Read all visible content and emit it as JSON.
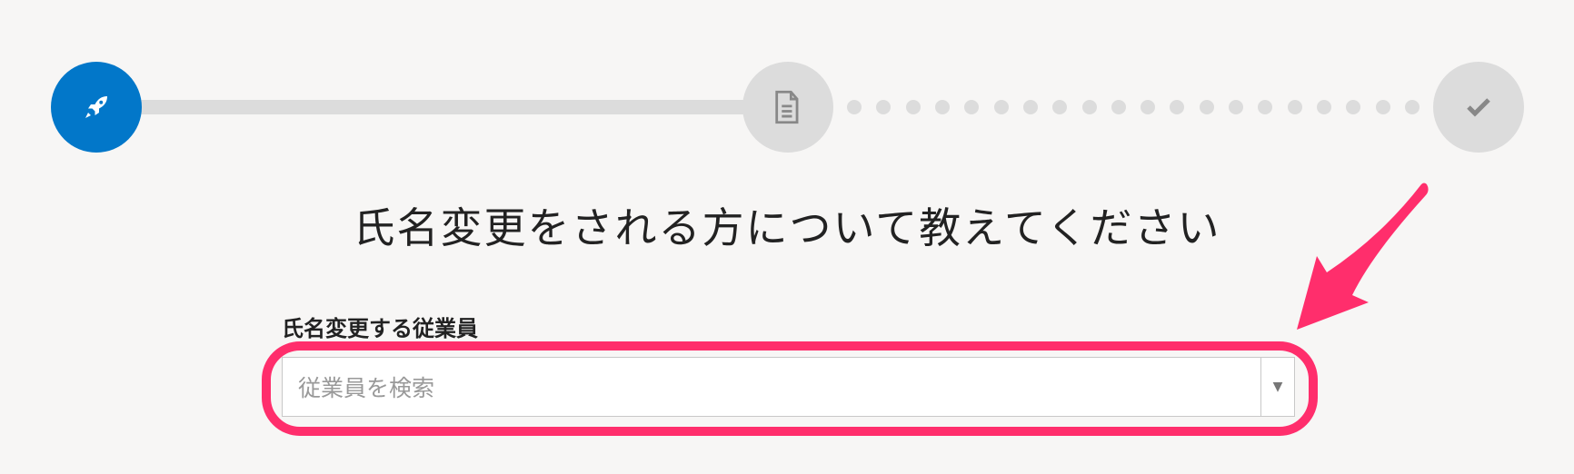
{
  "stepper": {
    "steps": [
      {
        "icon": "rocket-icon",
        "state": "active",
        "color": "#0277c9"
      },
      {
        "icon": "document-icon",
        "state": "pending"
      },
      {
        "icon": "check-icon",
        "state": "pending"
      }
    ]
  },
  "main": {
    "title": "氏名変更をされる方について教えてください",
    "employee_field": {
      "label": "氏名変更する従業員",
      "placeholder": "従業員を検索",
      "caret": "▼"
    }
  },
  "annotation": {
    "color": "#ff2e6c"
  }
}
